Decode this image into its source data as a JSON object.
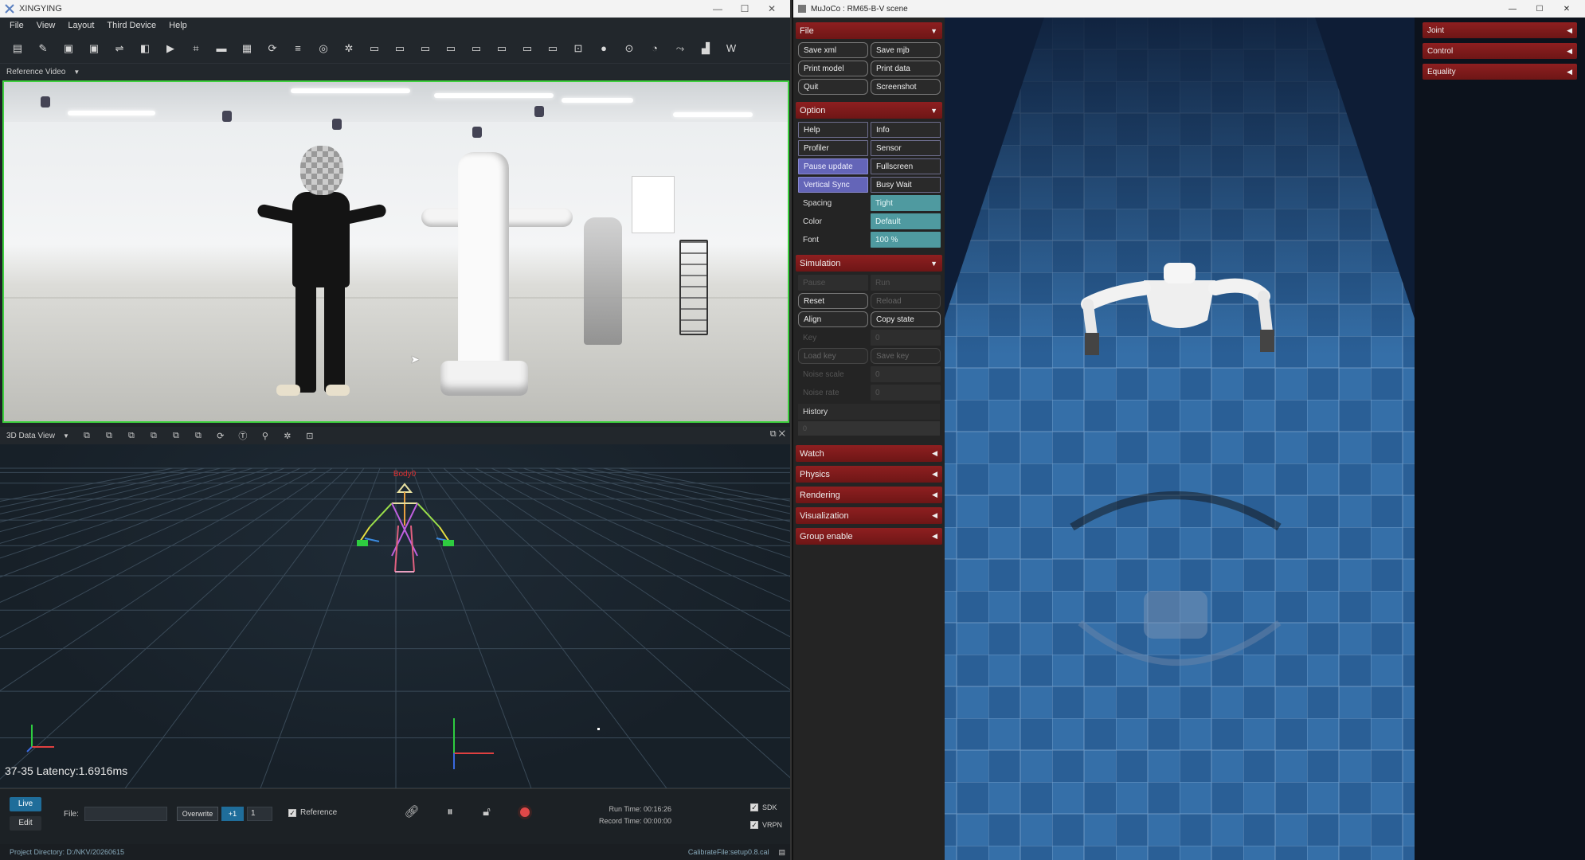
{
  "left_window": {
    "title": "XINGYING",
    "controls": [
      "—",
      "☐",
      "✕"
    ],
    "menu": [
      "File",
      "View",
      "Layout",
      "Third Device",
      "Help"
    ],
    "toolbar_icons": [
      "open-folder-icon",
      "pencil-icon",
      "save-icon",
      "save-as-icon",
      "link-icon",
      "columns-icon",
      "video-icon",
      "crop-icon",
      "bar-icon",
      "film-icon",
      "refresh-icon",
      "layers-icon",
      "database-icon",
      "gear-icon",
      "monitor-icon",
      "layout-1-icon",
      "layout-2-icon",
      "layout-3-icon",
      "layout-4-icon",
      "layout-5-icon",
      "layout-6-icon",
      "layout-7-icon",
      "lock-icon",
      "record-icon",
      "target-icon",
      "gauge-icon",
      "branch-icon",
      "chart-icon",
      "w-icon"
    ],
    "toolbar_glyphs": [
      "▤",
      "✎",
      "▣",
      "▣",
      "⇌",
      "◧",
      "▶",
      "⌗",
      "▬",
      "▦",
      "⟳",
      "≡",
      "◎",
      "✲",
      "▭",
      "▭",
      "▭",
      "▭",
      "▭",
      "▭",
      "▭",
      "▭",
      "⊡",
      "●",
      "⊙",
      "◔",
      "⤳",
      "▟",
      "W"
    ],
    "reference_video_label": "Reference Video",
    "view3d_label": "3D Data View",
    "view3d_icons": [
      "⧉",
      "⧉",
      "⧉",
      "⧉",
      "⧉",
      "⧉",
      "⟳",
      "Ⓣ",
      "⚲",
      "✲",
      "⊡"
    ],
    "view3d_icon_names": [
      "view-1-icon",
      "view-2-icon",
      "view-3-icon",
      "view-4-icon",
      "view-5-icon",
      "view-6-icon",
      "rotate-icon",
      "t-icon",
      "person-icon",
      "star-icon",
      "frame-icon"
    ],
    "view3d_right_controls": "⧉ ✕",
    "skeleton_label": "Body0",
    "latency": "37-35 Latency:1.6916ms",
    "bottom": {
      "live": "Live",
      "edit": "Edit",
      "file_label": "File:",
      "overwrite": "Overwrite",
      "plus_one": "+1",
      "number": "1",
      "reference": "Reference",
      "run_time": "Run Time: 00:16:26",
      "record_time": "Record Time: 00:00:00",
      "sdk": "SDK",
      "vrpn": "VRPN"
    },
    "status": {
      "project_directory": "Project Directory:  D:/NKV/20260615",
      "calibrate_file": "CalibrateFile:setup0.8.cal"
    },
    "colors": {
      "accent_green": "#3ecf3e",
      "live_blue": "#1f6d9a",
      "record_red": "#e04848"
    }
  },
  "right_window": {
    "title": "MuJoCo : RM65-B-V scene",
    "controls": [
      "—",
      "☐",
      "✕"
    ],
    "sections": {
      "file": {
        "label": "File",
        "buttons": [
          "Save xml",
          "Save mjb",
          "Print model",
          "Print data",
          "Quit",
          "Screenshot"
        ]
      },
      "option": {
        "label": "Option",
        "buttons": [
          "Help",
          "Info",
          "Profiler",
          "Sensor",
          "Pause update",
          "Fullscreen",
          "Vertical Sync",
          "Busy Wait"
        ],
        "spacing_label": "Spacing",
        "spacing_value": "Tight",
        "color_label": "Color",
        "color_value": "Default",
        "font_label": "Font",
        "font_value": "100 %"
      },
      "simulation": {
        "label": "Simulation",
        "pause": "Pause",
        "run": "Run",
        "reset": "Reset",
        "reload": "Reload",
        "align": "Align",
        "copy_state": "Copy state",
        "key_label": "Key",
        "key_value": "0",
        "load_key": "Load key",
        "save_key": "Save key",
        "noise_scale_label": "Noise scale",
        "noise_scale_value": "0",
        "noise_rate_label": "Noise rate",
        "noise_rate_value": "0",
        "history_label": "History",
        "history_value": "0"
      },
      "collapsed": [
        "Watch",
        "Physics",
        "Rendering",
        "Visualization",
        "Group enable"
      ]
    },
    "right_sections": [
      "Joint",
      "Control",
      "Equality"
    ],
    "colors": {
      "section_red": "#8e1f20",
      "toggle_on": "#6465b8",
      "value_teal": "#4f9aa0"
    }
  }
}
